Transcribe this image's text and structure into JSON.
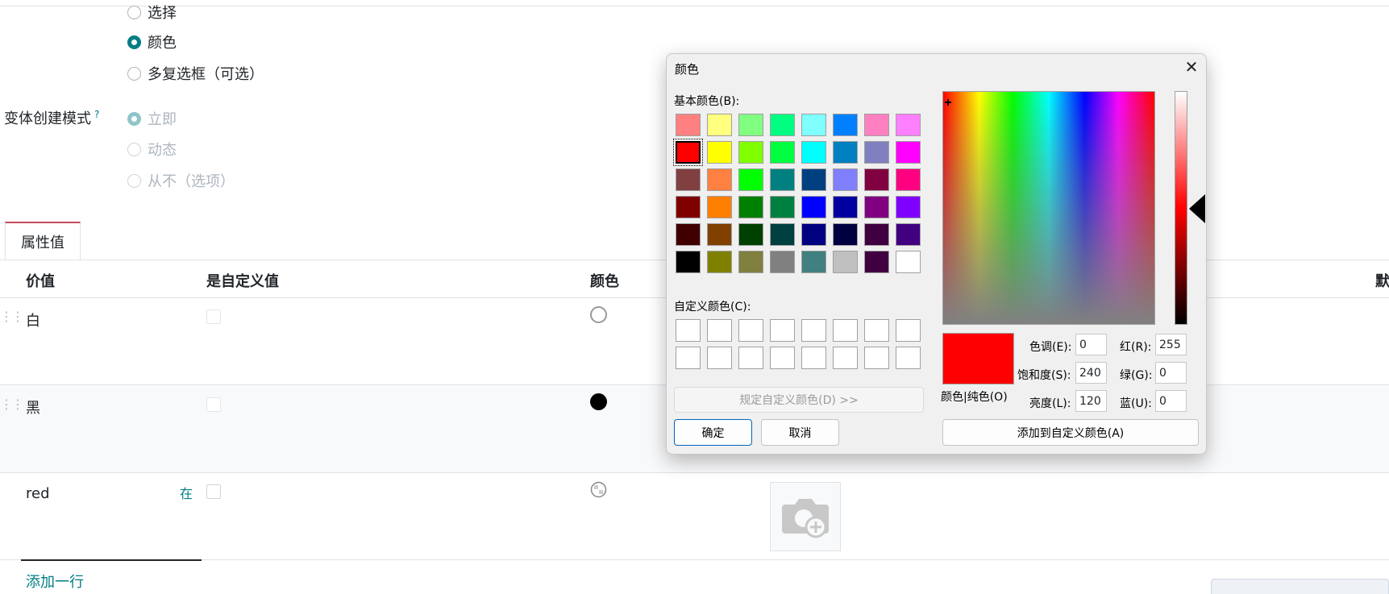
{
  "selection_type": {
    "options": [
      {
        "label": "选择",
        "checked": false,
        "dim": false
      },
      {
        "label": "颜色",
        "checked": true,
        "dim": false
      },
      {
        "label": "多复选框（可选）",
        "checked": false,
        "dim": false
      }
    ]
  },
  "variant_mode": {
    "label": "变体创建模式",
    "help": "?",
    "options": [
      {
        "label": "立即",
        "checked": true
      },
      {
        "label": "动态",
        "checked": false
      },
      {
        "label": "从不（选项）",
        "checked": false
      }
    ]
  },
  "tabs": [
    {
      "label": "属性值"
    }
  ],
  "table": {
    "headers": [
      "价值",
      "是自定义值",
      "颜色",
      "默"
    ],
    "rows": [
      {
        "value": "白",
        "custom_tag": "",
        "color": "#ffffff",
        "color_kind": "outline"
      },
      {
        "value": "黑",
        "custom_tag": "",
        "color": "#000000",
        "color_kind": "solid"
      },
      {
        "value": "red",
        "custom_tag": "在",
        "color": "",
        "color_kind": "empty"
      }
    ],
    "add_line": "添加一行"
  },
  "color_dialog": {
    "title": "颜色",
    "close": "✕",
    "basic_colors_label": "基本颜色(B):",
    "basic_colors": [
      "#ff8080",
      "#ffff80",
      "#80ff80",
      "#00ff80",
      "#80ffff",
      "#0080ff",
      "#ff80c0",
      "#ff80ff",
      "#ff0000",
      "#ffff00",
      "#80ff00",
      "#00ff40",
      "#00ffff",
      "#0080c0",
      "#8080c0",
      "#ff00ff",
      "#804040",
      "#ff8040",
      "#00ff00",
      "#008080",
      "#004080",
      "#8080ff",
      "#800040",
      "#ff0080",
      "#800000",
      "#ff8000",
      "#008000",
      "#008040",
      "#0000ff",
      "#0000a0",
      "#800080",
      "#8000ff",
      "#400000",
      "#804000",
      "#004000",
      "#004040",
      "#000080",
      "#000040",
      "#400040",
      "#400080",
      "#000000",
      "#808000",
      "#808040",
      "#808080",
      "#408080",
      "#c0c0c0",
      "#400040",
      "#ffffff"
    ],
    "selected_index": 8,
    "custom_colors_label": "自定义颜色(C):",
    "define_custom": "规定自定义颜色(D) >>",
    "ok": "确定",
    "cancel": "取消",
    "solid_label": "颜色|纯色(O)",
    "hue_label": "色调(E):",
    "hue": "0",
    "sat_label": "饱和度(S):",
    "sat": "240",
    "lum_label": "亮度(L):",
    "lum": "120",
    "red_label": "红(R):",
    "red": "255",
    "green_label": "绿(G):",
    "green": "0",
    "blue_label": "蓝(U):",
    "blue": "0",
    "add_custom": "添加到自定义颜色(A)"
  }
}
